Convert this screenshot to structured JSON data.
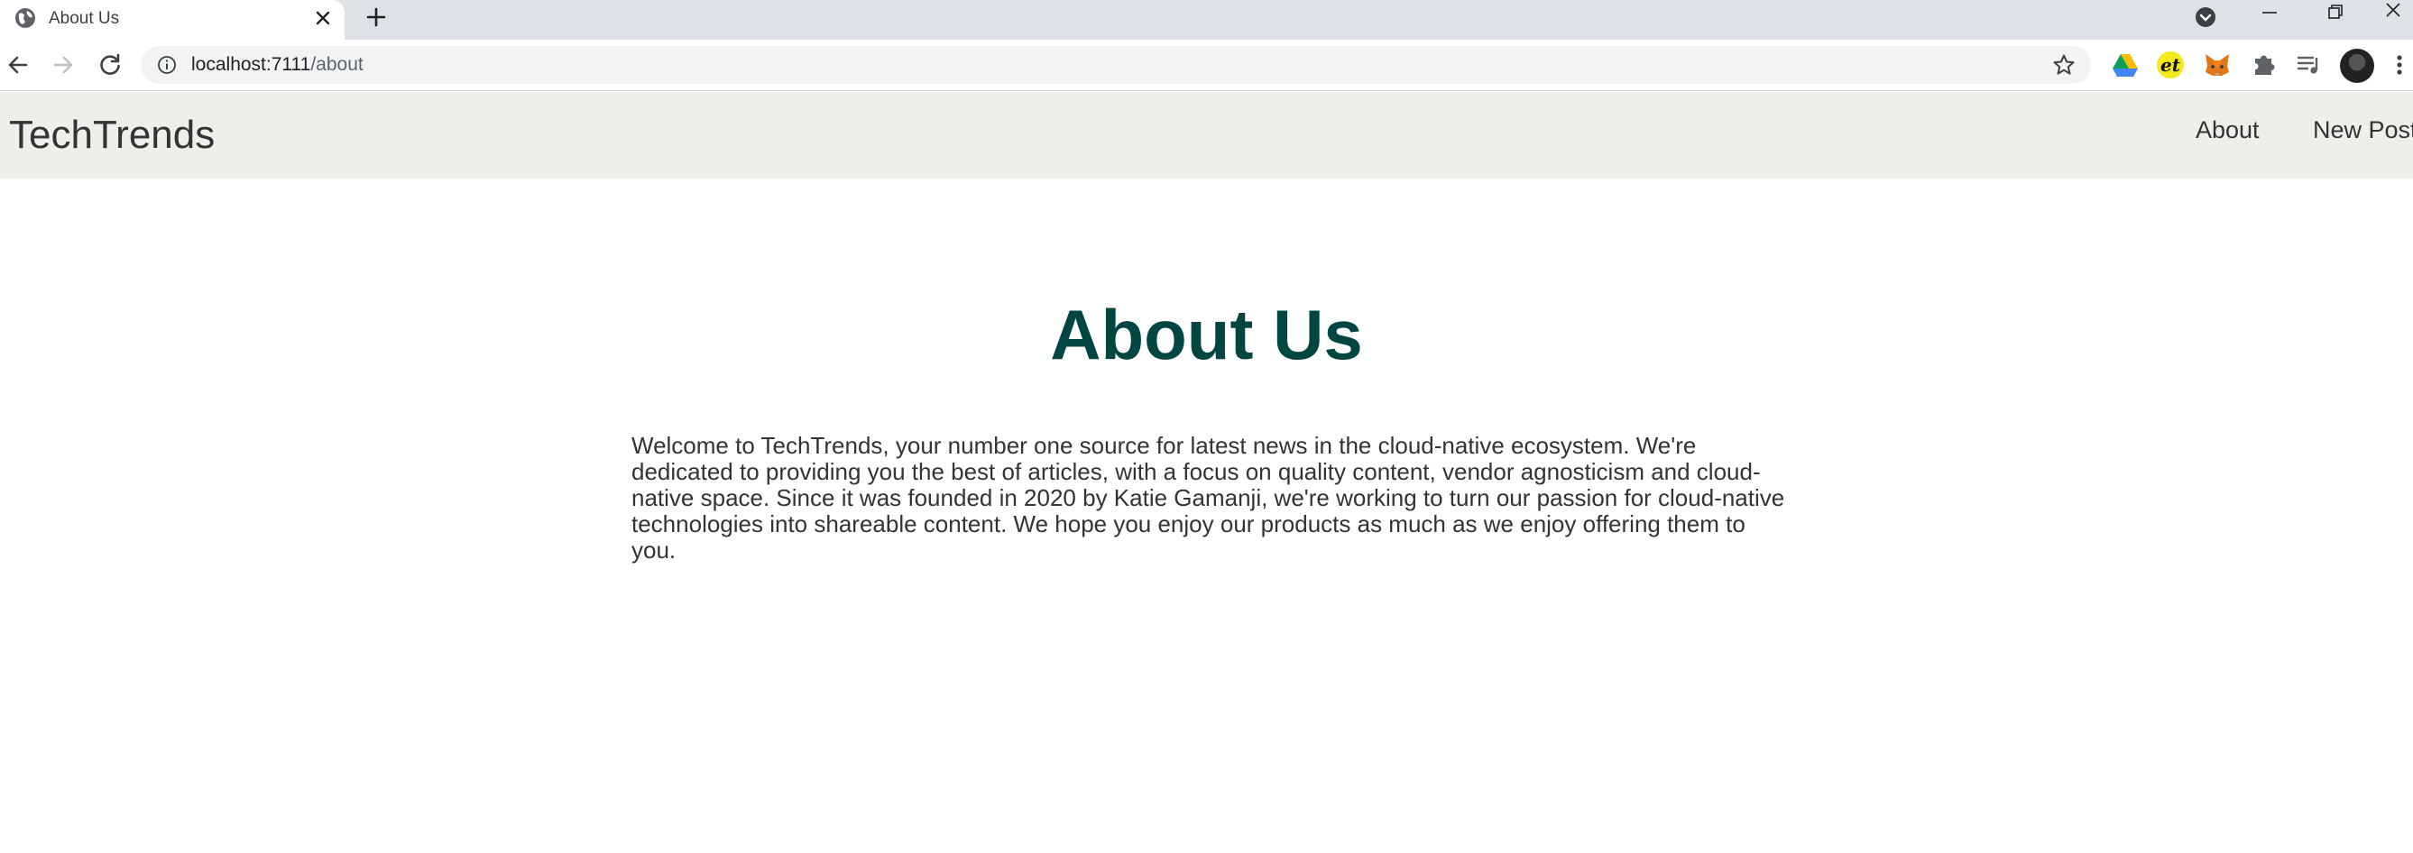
{
  "browser": {
    "tab": {
      "title": "About Us"
    },
    "address": {
      "host": "localhost:7111",
      "path": "/about"
    }
  },
  "site": {
    "brand": "TechTrends",
    "nav": [
      {
        "label": "About"
      },
      {
        "label": "New Post"
      }
    ]
  },
  "page": {
    "heading": "About Us",
    "intro": "Welcome to TechTrends, your number one source for latest news in the cloud-native ecosystem. We're dedicated to providing you the best of articles, with a focus on quality content, vendor agnosticism and cloud-native space. Since it was founded in 2020 by Katie Gamanji, we're working to turn our passion for cloud-native technologies into shareable content. We hope you enjoy our products as much as we enjoy offering them to you."
  },
  "colors": {
    "heading": "#024644",
    "navbar_bg": "#efeeeb",
    "text": "#333333"
  }
}
